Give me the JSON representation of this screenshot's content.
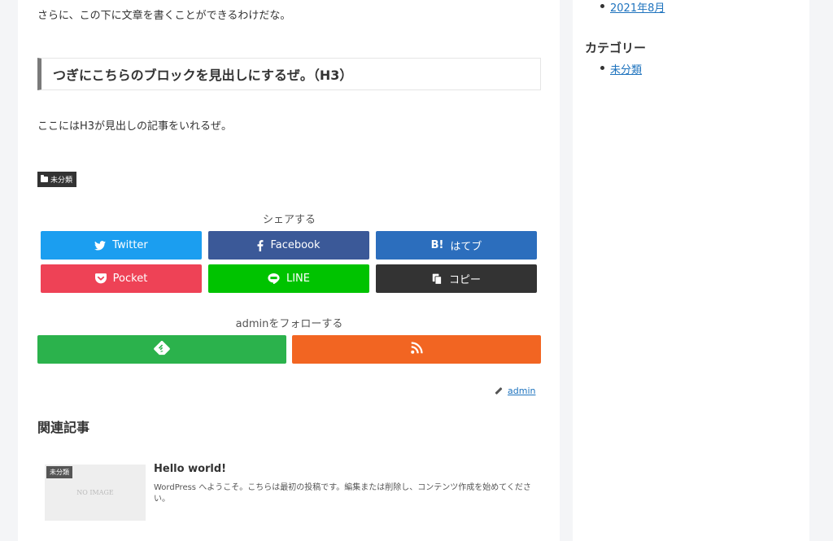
{
  "article": {
    "para1": "さらに、この下に文章を書くことができるわけだな。",
    "heading": "つぎにこちらのブロックを見出しにするぜ。（H3）",
    "para2": "ここにはH3が見出しの記事をいれるぜ。",
    "category": "未分類"
  },
  "share": {
    "title": "シェアする",
    "buttons": [
      {
        "label": "Twitter",
        "icon": "twitter-bird-icon",
        "color": "#1b9ef0"
      },
      {
        "label": "Facebook",
        "icon": "facebook-f-icon",
        "color": "#3b5998"
      },
      {
        "label": "はてブ",
        "icon": "hatena-bookmark-icon",
        "icon_text": "B!",
        "color": "#2c6ebd"
      },
      {
        "label": "Pocket",
        "icon": "pocket-icon",
        "color": "#ee4256"
      },
      {
        "label": "LINE",
        "icon": "line-icon",
        "color": "#00c300"
      },
      {
        "label": "コピー",
        "icon": "copy-icon",
        "color": "#333333"
      }
    ]
  },
  "follow": {
    "title": "adminをフォローする",
    "buttons": [
      {
        "icon": "feedly-icon",
        "color": "#2bb24c"
      },
      {
        "icon": "rss-icon",
        "color": "#f26522"
      }
    ]
  },
  "author": {
    "name": "admin"
  },
  "related": {
    "title": "関連記事",
    "items": [
      {
        "category": "未分類",
        "thumb_text": "NO IMAGE",
        "title": "Hello world!",
        "excerpt": "WordPress へようこそ。こちらは最初の投稿です。編集または削除し、コンテンツ作成を始めてください。"
      }
    ]
  },
  "sidebar": {
    "archive_item": "2021年8月",
    "category_heading": "カテゴリー",
    "category_item": "未分類"
  }
}
